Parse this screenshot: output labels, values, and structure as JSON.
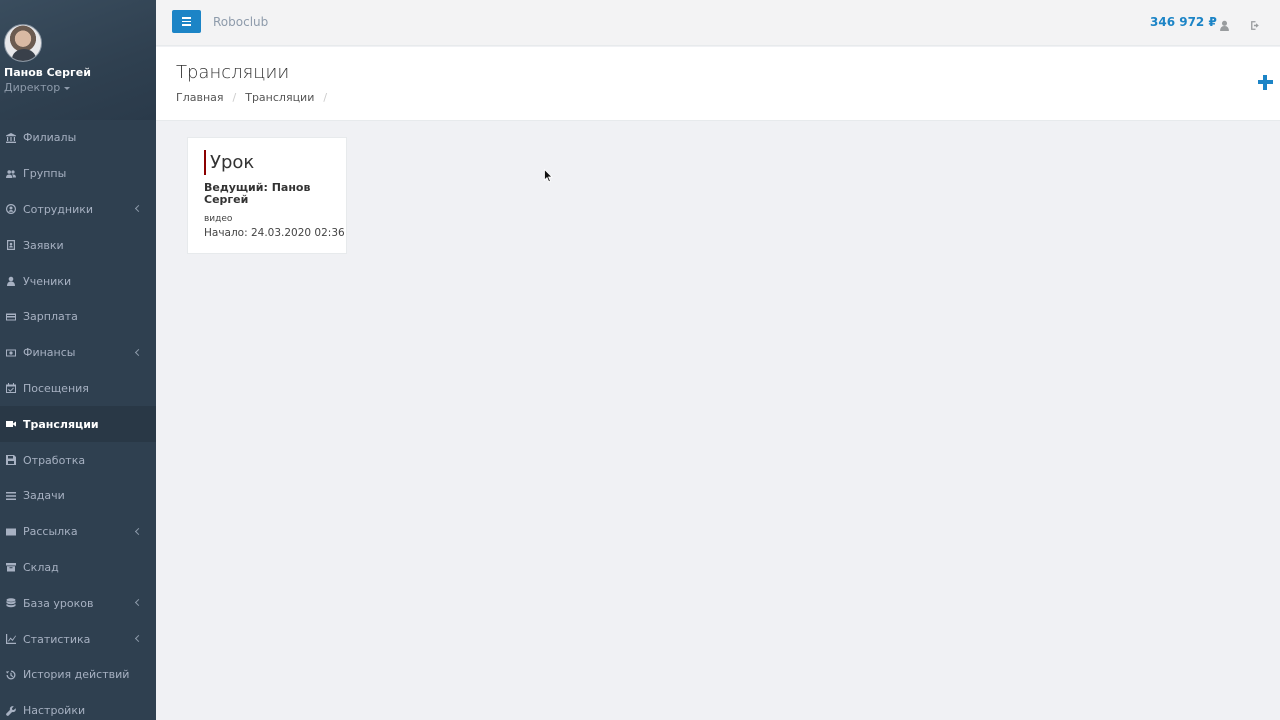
{
  "profile": {
    "name": "Панов Сергей",
    "role": "Директор"
  },
  "nav": [
    {
      "label": "Филиалы",
      "icon": "bank-icon",
      "has_submenu": false
    },
    {
      "label": "Группы",
      "icon": "users-icon",
      "has_submenu": false
    },
    {
      "label": "Сотрудники",
      "icon": "user-circle-icon",
      "has_submenu": true
    },
    {
      "label": "Заявки",
      "icon": "address-book-icon",
      "has_submenu": false
    },
    {
      "label": "Ученики",
      "icon": "user-icon",
      "has_submenu": false
    },
    {
      "label": "Зарплата",
      "icon": "credit-card-icon",
      "has_submenu": false
    },
    {
      "label": "Финансы",
      "icon": "money-icon",
      "has_submenu": true
    },
    {
      "label": "Посещения",
      "icon": "calendar-check-icon",
      "has_submenu": false
    },
    {
      "label": "Трансляции",
      "icon": "video-camera-icon",
      "has_submenu": false,
      "active": true
    },
    {
      "label": "Отработка",
      "icon": "save-icon",
      "has_submenu": false
    },
    {
      "label": "Задачи",
      "icon": "tasks-icon",
      "has_submenu": false
    },
    {
      "label": "Рассылка",
      "icon": "envelope-icon",
      "has_submenu": true
    },
    {
      "label": "Склад",
      "icon": "archive-icon",
      "has_submenu": false
    },
    {
      "label": "База уроков",
      "icon": "database-icon",
      "has_submenu": true
    },
    {
      "label": "Статистика",
      "icon": "line-chart-icon",
      "has_submenu": true
    },
    {
      "label": "История действий",
      "icon": "history-icon",
      "has_submenu": false
    },
    {
      "label": "Настройки",
      "icon": "wrench-icon",
      "has_submenu": false
    }
  ],
  "topbar": {
    "brand": "Roboclub",
    "balance": "346 972 ₽"
  },
  "page": {
    "title": "Трансляции",
    "breadcrumb": [
      "Главная",
      "Трансляции"
    ]
  },
  "broadcasts": [
    {
      "title": "Урок",
      "host": "Ведущий: Панов Сергей",
      "type": "видео",
      "start": "Начало: 24.03.2020 02:36"
    }
  ],
  "colors": {
    "sidebar": "#2f4050",
    "accent": "#1c84c6",
    "card_marker": "#8b0000"
  }
}
